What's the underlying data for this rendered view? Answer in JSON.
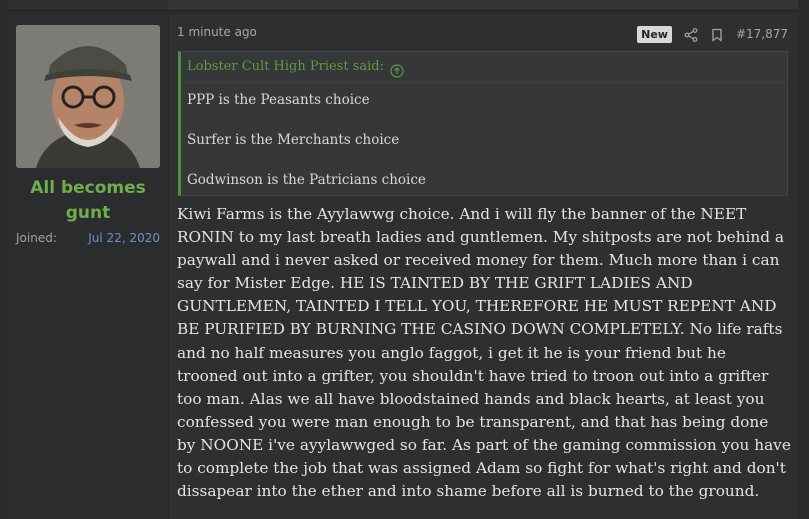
{
  "user": {
    "name": "All becomes gunt",
    "joined_label": "Joined:",
    "joined_value": "Jul 22, 2020"
  },
  "post": {
    "time": "1 minute ago",
    "badge": "New",
    "number": "#17,877",
    "icons": [
      "share-icon",
      "bookmark-icon",
      "expand-quote-icon"
    ],
    "quote": {
      "author": "Lobster Cult High Priest said:",
      "lines": [
        "PPP is the Peasants choice",
        "Surfer is the Merchants choice",
        "Godwinson is the Patricians choice"
      ]
    },
    "body": "Kiwi Farms is the Ayylawwg choice. And i will fly the banner of the NEET RONIN to my last breath ladies and guntlemen. My shitposts are not behind a paywall and i never asked or received money for them. Much more than i can say for Mister Edge. HE IS TAINTED BY THE GRIFT LADIES AND GUNTLEMEN, TAINTED I TELL YOU, THEREFORE HE MUST REPENT AND BE PURIFIED BY BURNING THE CASINO DOWN COMPLETELY. No life rafts and no half measures you anglo faggot, i get it he is your friend but he trooned out into a grifter, you shouldn't have tried to troon out into a grifter too man. Alas we all have bloodstained hands and black hearts, at least you confessed you were man enough to be transparent, and that has being done by NOONE i've ayylawwged so far. As part of the gaming commission you have to complete the job that was assigned Adam so fight for what's right and don't dissapear into the ether and into shame before all is burned to the ground."
  },
  "colors": {
    "username": "#6fae4a",
    "quote_accent": "#4e8f3b",
    "joined_value": "#6f8fd0"
  }
}
